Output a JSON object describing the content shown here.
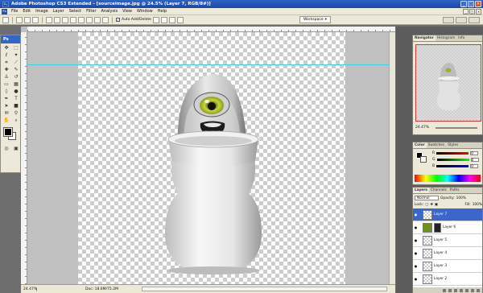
{
  "window": {
    "title": "Adobe Photoshop CS3 Extended - [sourceimage.jpg @ 24.5% (Layer 7, RGB/8#)]",
    "logo": "Ps"
  },
  "menu": [
    "File",
    "Edit",
    "Image",
    "Layer",
    "Select",
    "Filter",
    "Analysis",
    "View",
    "Window",
    "Help"
  ],
  "options": {
    "auto_add_delete_label": "Auto Add/Delete",
    "workspace_label": "Workspace"
  },
  "toolbox": {
    "badge": "Ps"
  },
  "status": {
    "zoom": "24.47%",
    "doc": "Doc: 18.6M/75.2M"
  },
  "navigator": {
    "tabs": [
      "Navigator",
      "Histogram",
      "Info"
    ],
    "zoom": "24.47%"
  },
  "color_panel": {
    "tabs": [
      "Color",
      "Swatches",
      "Styles"
    ],
    "channels": [
      {
        "label": "R",
        "value": "0"
      },
      {
        "label": "G",
        "value": "0"
      },
      {
        "label": "B",
        "value": "0"
      }
    ]
  },
  "layers_panel": {
    "tabs": [
      "Layers",
      "Channels",
      "Paths"
    ],
    "blend_mode": "Normal",
    "opacity_label": "Opacity:",
    "opacity": "100%",
    "lock_label": "Lock:",
    "fill_label": "Fill:",
    "fill": "100%",
    "layers": [
      {
        "name": "Layer 7",
        "selected": true
      },
      {
        "name": "Layer 6",
        "selected": false
      },
      {
        "name": "Layer 5",
        "selected": false
      },
      {
        "name": "Layer 4",
        "selected": false
      },
      {
        "name": "Layer 3",
        "selected": false
      },
      {
        "name": "Layer 2",
        "selected": false
      }
    ]
  },
  "colors": {
    "title_bar": "#1b47a8",
    "selected_layer": "#3a67c9",
    "guide": "#38d3e6"
  }
}
